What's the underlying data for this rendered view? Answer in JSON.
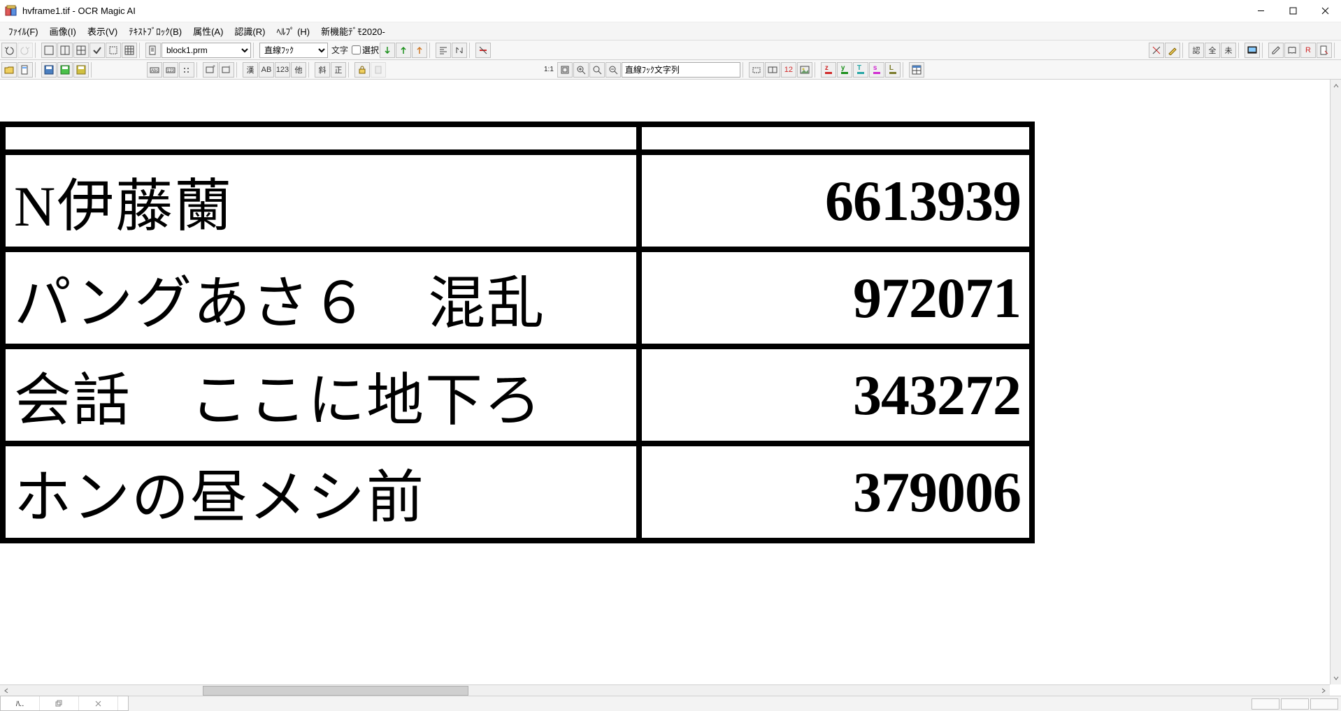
{
  "window": {
    "title": "hvframe1.tif - OCR Magic AI"
  },
  "menu": {
    "file": "ﾌｧｲﾙ(F)",
    "image": "画像(I)",
    "view": "表示(V)",
    "textblock": "ﾃｷｽﾄﾌﾞﾛｯｸ(B)",
    "attr": "属性(A)",
    "recognize": "認識(R)",
    "help": "ﾍﾙﾌﾟ (H)",
    "newfeat": "新機能ﾃﾞﾓ2020-"
  },
  "toolbar1": {
    "block_param": "block1.prm",
    "hook_select": "直線ﾌｯｸ",
    "moji_label": "文字",
    "sentaku_label": "選択"
  },
  "toolbar2": {
    "zoom_label": "1:1",
    "hook_text": "直線ﾌｯｸ文字列",
    "kan": "漢",
    "ab": "AB",
    "n123": "123",
    "hoka": "他",
    "sha": "斜",
    "sei": "正",
    "r_12": "12",
    "r_ninshiki": "認",
    "r_zen": "全",
    "r_mi": "未",
    "r_R": "R",
    "r_z": "z",
    "r_y": "y",
    "r_t": "T",
    "r_s": "s",
    "r_l": "L"
  },
  "document": {
    "rows": [
      {
        "left": "N伊藤蘭",
        "right": "6613939"
      },
      {
        "left": "パングあさ６　混乱",
        "right": "972071"
      },
      {
        "left": "会話　ここに地下ろ",
        "right": "343272"
      },
      {
        "left": "ホンの昼メシ前",
        "right": "379006"
      }
    ]
  },
  "tabtray": {
    "t1": "ﾊ..",
    "t2": "",
    "t3": ""
  }
}
